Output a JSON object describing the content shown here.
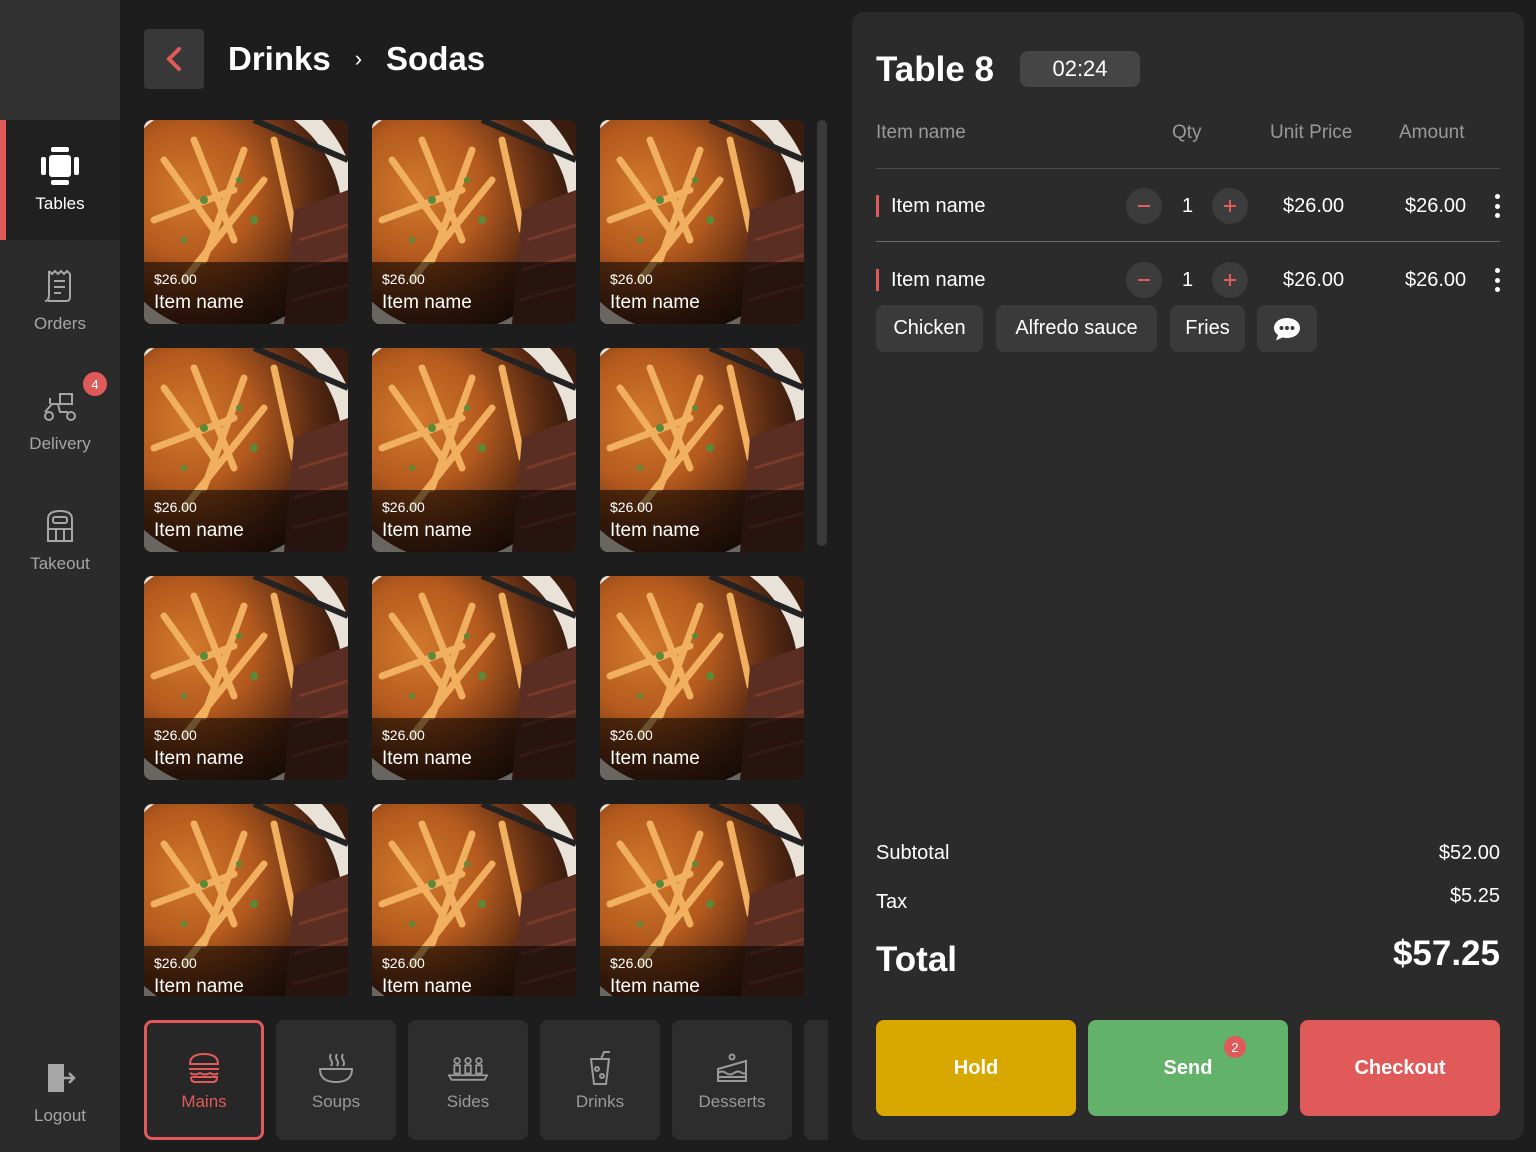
{
  "sidebar": {
    "items": [
      {
        "label": "Tables",
        "icon": "tables-icon",
        "active": true
      },
      {
        "label": "Orders",
        "icon": "orders-icon"
      },
      {
        "label": "Delivery",
        "icon": "delivery-icon",
        "badge": "4"
      },
      {
        "label": "Takeout",
        "icon": "takeout-icon"
      }
    ],
    "logout": "Logout"
  },
  "breadcrumb": {
    "parent": "Drinks",
    "separator": "›",
    "current": "Sodas"
  },
  "menu_items": [
    {
      "price": "$26.00",
      "name": "Item name"
    },
    {
      "price": "$26.00",
      "name": "Item name"
    },
    {
      "price": "$26.00",
      "name": "Item name"
    },
    {
      "price": "$26.00",
      "name": "Item name"
    },
    {
      "price": "$26.00",
      "name": "Item name"
    },
    {
      "price": "$26.00",
      "name": "Item name"
    },
    {
      "price": "$26.00",
      "name": "Item name"
    },
    {
      "price": "$26.00",
      "name": "Item name"
    },
    {
      "price": "$26.00",
      "name": "Item name"
    },
    {
      "price": "$26.00",
      "name": "Item name"
    },
    {
      "price": "$26.00",
      "name": "Item name"
    },
    {
      "price": "$26.00",
      "name": "Item name"
    }
  ],
  "categories": [
    {
      "label": "Mains",
      "icon": "burger-icon",
      "active": true
    },
    {
      "label": "Soups",
      "icon": "soup-bowl-icon"
    },
    {
      "label": "Sides",
      "icon": "sides-icon"
    },
    {
      "label": "Drinks",
      "icon": "drink-icon"
    },
    {
      "label": "Desserts",
      "icon": "cake-icon"
    }
  ],
  "order": {
    "table": "Table 8",
    "timer": "02:24",
    "columns": {
      "name": "Item name",
      "qty": "Qty",
      "unit": "Unit Price",
      "amount": "Amount"
    },
    "lines": [
      {
        "name": "Item name",
        "qty": "1",
        "unit": "$26.00",
        "amount": "$26.00"
      },
      {
        "name": "Item name",
        "qty": "1",
        "unit": "$26.00",
        "amount": "$26.00",
        "modifiers": [
          "Chicken",
          "Alfredo sauce",
          "Fries"
        ]
      }
    ],
    "subtotal_label": "Subtotal",
    "subtotal": "$52.00",
    "tax_label": "Tax",
    "tax": "$5.25",
    "total_label": "Total",
    "total": "$57.25"
  },
  "actions": {
    "hold": "Hold",
    "send": "Send",
    "send_badge": "2",
    "checkout": "Checkout"
  },
  "colors": {
    "accent": "#e05a5a",
    "hold": "#d9a800",
    "send": "#62b26a",
    "checkout": "#e05a5a"
  }
}
